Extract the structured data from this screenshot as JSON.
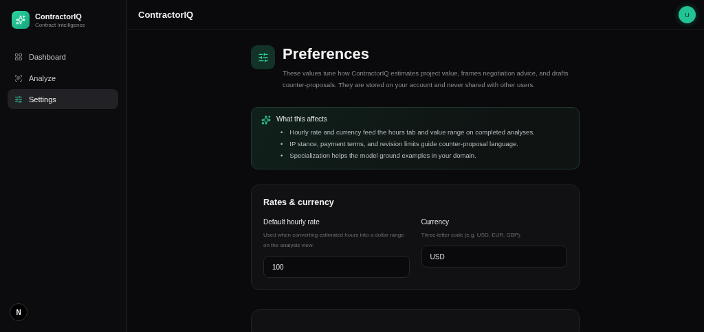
{
  "sidebar": {
    "brand": {
      "name": "ContractorIQ",
      "tagline": "Contract Intelligence"
    },
    "items": [
      {
        "label": "Dashboard",
        "selected": false
      },
      {
        "label": "Analyze",
        "selected": false
      },
      {
        "label": "Settings",
        "selected": true
      }
    ],
    "dev_badge": "N"
  },
  "header": {
    "title": "ContractorIQ",
    "avatar": "U"
  },
  "page": {
    "title": "Preferences",
    "description": "These values tune how ContractorIQ estimates project value, frames negotiation advice, and drafts counter-proposals. They are stored on your account and never shared with other users."
  },
  "info": {
    "title": "What this affects",
    "bullets": [
      {
        "marker": "•",
        "text": "Hourly rate and currency feed the hours tab and value range on completed analyses."
      },
      {
        "marker": "•",
        "text": "IP stance, payment terms, and revision limits guide counter-proposal language."
      },
      {
        "marker": "•",
        "text": "Specialization helps the model ground examples in your domain."
      }
    ]
  },
  "rates": {
    "title": "Rates & currency",
    "fields": [
      {
        "label": "Default hourly rate",
        "help": "Used when converting estimated hours into a dollar range on the analysis view.",
        "value": "100"
      },
      {
        "label": "Currency",
        "help": "Three-letter code (e.g. USD, EUR, GBP).",
        "value": "USD"
      }
    ]
  }
}
